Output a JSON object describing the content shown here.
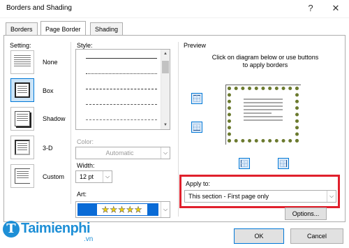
{
  "window": {
    "title": "Borders and Shading",
    "help": "?",
    "close": "✕"
  },
  "tabs": [
    {
      "label": "Borders",
      "active": false
    },
    {
      "label": "Page Border",
      "active": true
    },
    {
      "label": "Shading",
      "active": false
    }
  ],
  "setting": {
    "heading": "Setting:",
    "items": [
      {
        "label": "None",
        "selected": false
      },
      {
        "label": "Box",
        "selected": true
      },
      {
        "label": "Shadow",
        "selected": false
      },
      {
        "label": "3-D",
        "selected": false
      },
      {
        "label": "Custom",
        "selected": false
      }
    ]
  },
  "style": {
    "heading": "Style:"
  },
  "color": {
    "label": "Color:",
    "value": "Automatic"
  },
  "width": {
    "label": "Width:",
    "value": "12 pt"
  },
  "art": {
    "label": "Art:",
    "value": "★★★★★"
  },
  "preview": {
    "heading": "Preview",
    "instruction_line1": "Click on diagram below or use buttons",
    "instruction_line2": "to apply borders"
  },
  "apply_to": {
    "label": "Apply to:",
    "value": "This section - First page only"
  },
  "options_button": "Options...",
  "ok_button": "OK",
  "cancel_button": "Cancel",
  "watermark": {
    "text": "Taimienphi",
    "suffix": ".vn"
  },
  "colors": {
    "accent": "#0078d7",
    "highlight": "#e0202c",
    "art_bg": "#0a6bd6",
    "star": "#f5d400"
  }
}
